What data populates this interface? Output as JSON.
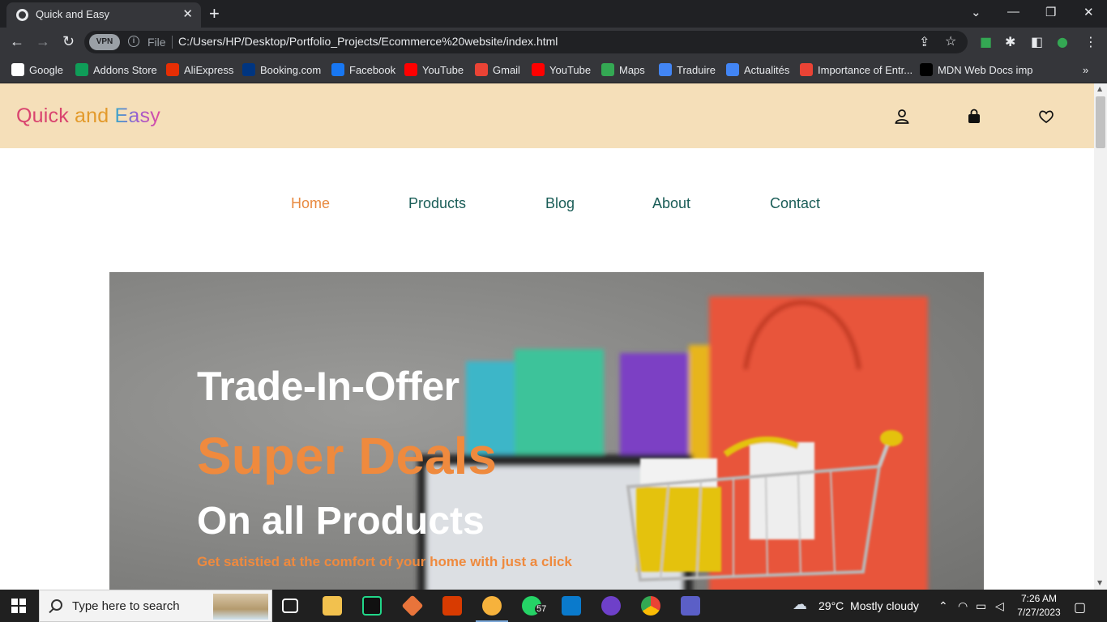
{
  "browser": {
    "tab_title": "Quick and Easy",
    "tab_close": "✕",
    "new_tab": "+",
    "window_controls": [
      "⌄",
      "—",
      "❐",
      "✕"
    ],
    "vpn_label": "VPN",
    "file_label": "File",
    "url": "C:/Users/HP/Desktop/Portfolio_Projects/Ecommerce%20website/index.html",
    "bookmarks": [
      {
        "label": "Google",
        "icon": "google-icon",
        "color": "#ffffff"
      },
      {
        "label": "Addons Store",
        "icon": "addons-icon",
        "color": "#0f9d58"
      },
      {
        "label": "AliExpress",
        "icon": "aliexpress-icon",
        "color": "#e62e04"
      },
      {
        "label": "Booking.com",
        "icon": "booking-icon",
        "color": "#003580"
      },
      {
        "label": "Facebook",
        "icon": "facebook-icon",
        "color": "#1877f2"
      },
      {
        "label": "YouTube",
        "icon": "youtube-icon",
        "color": "#ff0000"
      },
      {
        "label": "Gmail",
        "icon": "gmail-icon",
        "color": "#ea4335"
      },
      {
        "label": "YouTube",
        "icon": "youtube-icon",
        "color": "#ff0000"
      },
      {
        "label": "Maps",
        "icon": "maps-icon",
        "color": "#34a853"
      },
      {
        "label": "Traduire",
        "icon": "translate-icon",
        "color": "#4285f4"
      },
      {
        "label": "Actualités",
        "icon": "news-icon",
        "color": "#4285f4"
      },
      {
        "label": "Importance of Entr...",
        "icon": "gmail-icon",
        "color": "#ea4335"
      },
      {
        "label": "MDN Web Docs imp",
        "icon": "mdn-icon",
        "color": "#000000"
      }
    ],
    "bookmarks_more": "»"
  },
  "site": {
    "logo": [
      "Quick",
      " and ",
      "Easy"
    ],
    "logo_colors": [
      "#d9446f",
      "#e39a2b",
      "#6c7bd8"
    ],
    "nav": [
      {
        "label": "Home",
        "active": true
      },
      {
        "label": "Products",
        "active": false
      },
      {
        "label": "Blog",
        "active": false
      },
      {
        "label": "About",
        "active": false
      },
      {
        "label": "Contact",
        "active": false
      }
    ],
    "hero": {
      "line1": "Trade-In-Offer",
      "line2": "Super Deals",
      "line3": "On all Products",
      "tagline": "Get satistied at the comfort of your home with just a click"
    },
    "accent_color": "#ef8a3e",
    "header_bg": "#f5dfb9",
    "nav_color": "#1a5d57"
  },
  "taskbar": {
    "search_placeholder": "Type here to search",
    "whatsapp_badge": "57",
    "weather": "29°C  Mostly cloudy",
    "time": "7:26 AM",
    "date": "7/27/2023"
  }
}
